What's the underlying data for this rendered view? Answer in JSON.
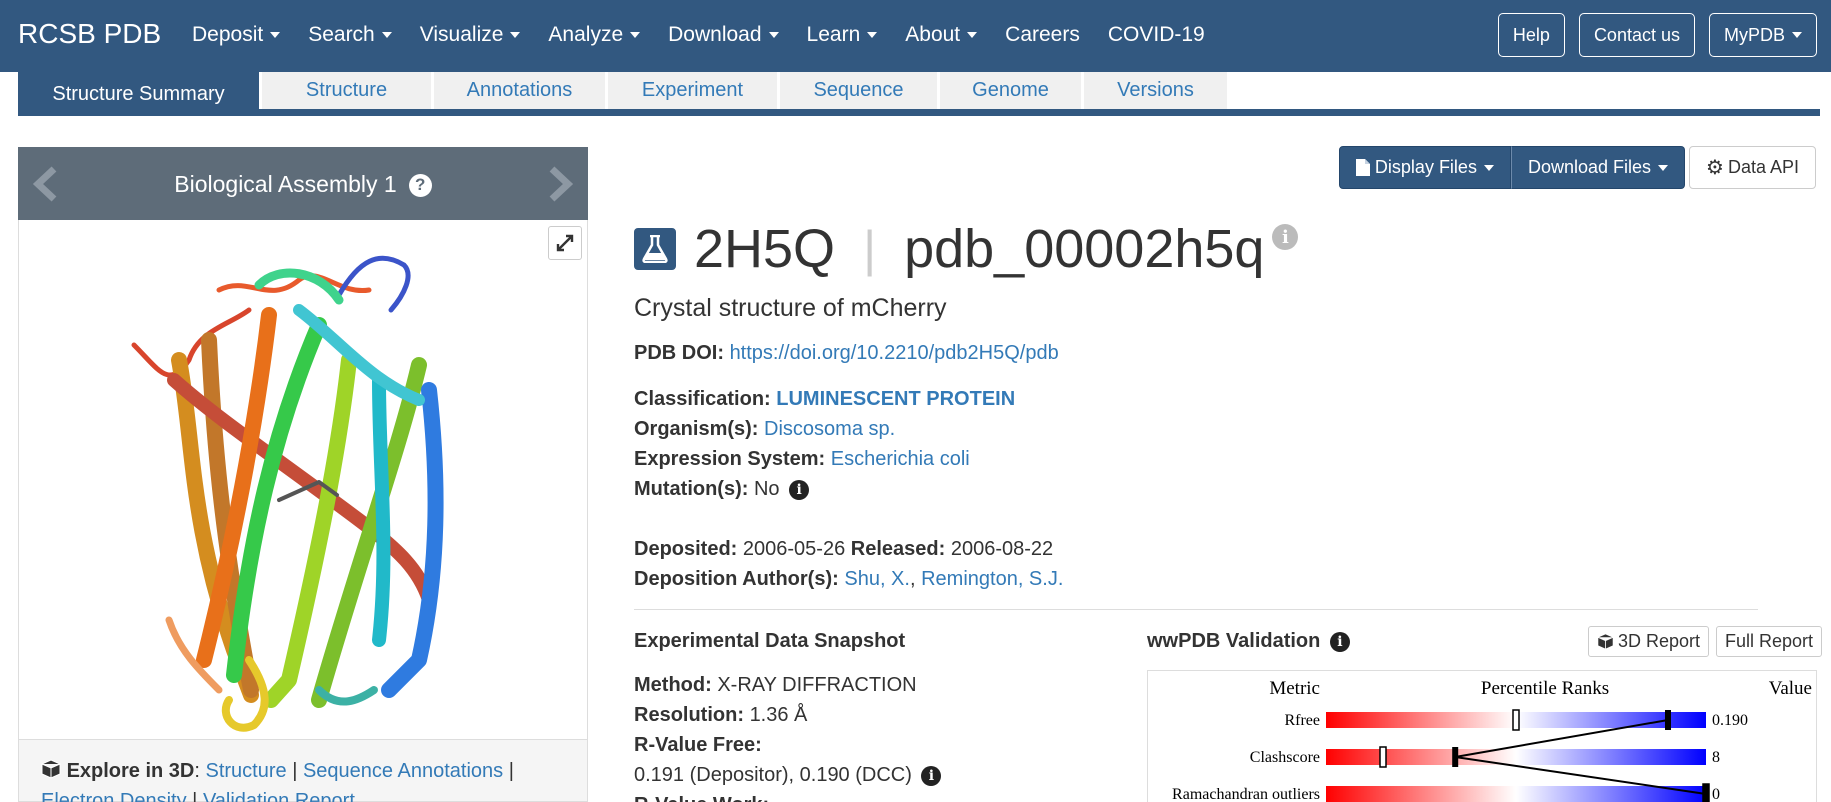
{
  "nav": {
    "brand": "RCSB PDB",
    "menu": [
      {
        "label": "Deposit",
        "dropdown": true
      },
      {
        "label": "Search",
        "dropdown": true
      },
      {
        "label": "Visualize",
        "dropdown": true
      },
      {
        "label": "Analyze",
        "dropdown": true
      },
      {
        "label": "Download",
        "dropdown": true
      },
      {
        "label": "Learn",
        "dropdown": true
      },
      {
        "label": "About",
        "dropdown": true
      },
      {
        "label": "Careers",
        "dropdown": false
      },
      {
        "label": "COVID-19",
        "dropdown": false
      }
    ],
    "right": {
      "help": "Help",
      "contact": "Contact us",
      "mypdb": "MyPDB"
    }
  },
  "tabs": [
    "Structure Summary",
    "Structure",
    "Annotations",
    "Experiment",
    "Sequence",
    "Genome",
    "Versions"
  ],
  "assembly": {
    "title": "Biological Assembly 1",
    "help": "?"
  },
  "explore": {
    "label": "Explore in 3D",
    "links": [
      "Structure",
      "Sequence Annotations",
      "Electron Density",
      "Validation Report"
    ]
  },
  "toolbar": {
    "display_files": "Display Files",
    "download_files": "Download Files",
    "data_api": "Data API"
  },
  "entry": {
    "id": "2H5Q",
    "separator": "|",
    "ext_id": "pdb_00002h5q",
    "title": "Crystal structure of mCherry",
    "doi_label": "PDB DOI:",
    "doi": "https://doi.org/10.2210/pdb2H5Q/pdb",
    "classification_label": "Classification:",
    "classification": "LUMINESCENT PROTEIN",
    "organism_label": "Organism(s):",
    "organism": "Discosoma sp.",
    "expression_label": "Expression System:",
    "expression": "Escherichia coli",
    "mutation_label": "Mutation(s):",
    "mutation": "No",
    "deposited_label": "Deposited:",
    "deposited": "2006-05-26",
    "released_label": "Released:",
    "released": "2006-08-22",
    "authors_label": "Deposition Author(s):",
    "authors": [
      "Shu, X.",
      "Remington, S.J."
    ]
  },
  "experimental": {
    "title": "Experimental Data Snapshot",
    "method_label": "Method:",
    "method": "X-RAY DIFFRACTION",
    "resolution_label": "Resolution:",
    "resolution": "1.36 Å",
    "rfree_label": "R-Value Free:",
    "rfree": "0.191 (Depositor), 0.190 (DCC)",
    "rwork_label": "R-Value Work:"
  },
  "validation": {
    "title": "wwPDB Validation",
    "report_3d": "3D Report",
    "full_report": "Full Report",
    "header_metric": "Metric",
    "header_percentile": "Percentile Ranks",
    "header_value": "Value",
    "rows": [
      {
        "metric": "Rfree",
        "value": "0.190",
        "pct_all": 0.5,
        "pct_res": 0.9
      },
      {
        "metric": "Clashscore",
        "value": "8",
        "pct_all": 0.15,
        "pct_res": 0.34
      },
      {
        "metric": "Ramachandran outliers",
        "value": "0",
        "pct_all": 1.0,
        "pct_res": 1.0
      }
    ]
  }
}
